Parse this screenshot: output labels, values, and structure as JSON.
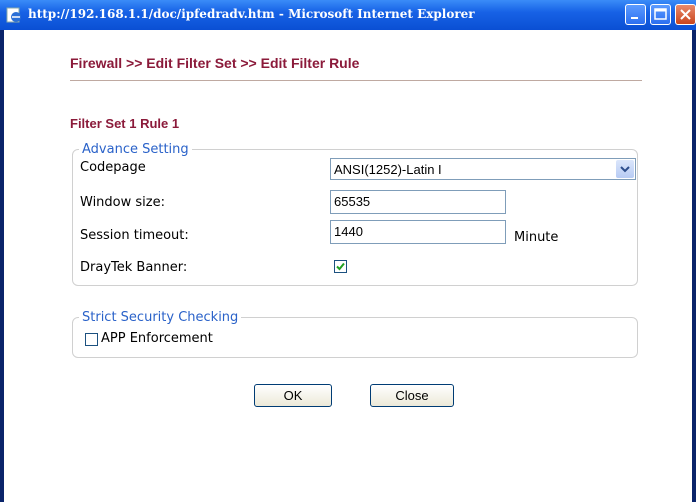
{
  "window": {
    "title": "http://192.168.1.1/doc/ipfedradv.htm - Microsoft Internet Explorer"
  },
  "page": {
    "breadcrumb": "Firewall >> Edit Filter Set >> Edit Filter Rule",
    "set_title": "Filter Set 1 Rule 1"
  },
  "advance": {
    "legend": "Advance Setting",
    "codepage_label": "Codepage",
    "codepage_value": "ANSI(1252)-Latin I",
    "window_size_label": "Window size:",
    "window_size_value": "65535",
    "session_timeout_label": "Session timeout:",
    "session_timeout_value": "1440",
    "session_timeout_unit": "Minute",
    "banner_label": "DrayTek Banner:",
    "banner_checked": true
  },
  "strict": {
    "legend": "Strict Security Checking",
    "app_enforcement_label": "APP Enforcement",
    "app_enforcement_checked": false
  },
  "buttons": {
    "ok": "OK",
    "close": "Close"
  },
  "colors": {
    "title_bar": "#1762e6",
    "heading": "#8b1a3a",
    "legend": "#2a62c9"
  }
}
